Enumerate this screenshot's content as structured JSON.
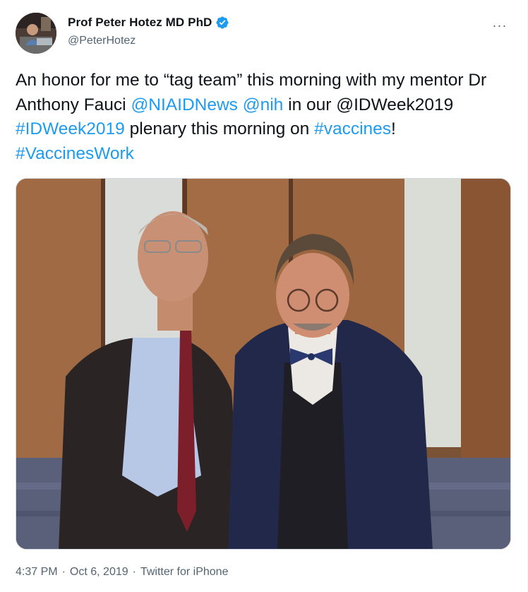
{
  "author": {
    "name": "Prof Peter Hotez MD PhD",
    "handle": "@PeterHotez",
    "verified": true,
    "avatar_icon": "profile-avatar"
  },
  "more_icon": "ellipsis-icon",
  "more_label": "···",
  "tweet": {
    "segments": [
      {
        "text": "An honor for me to “tag team” this morning with my mentor Dr Anthony Fauci ",
        "link": false
      },
      {
        "text": "@NIAIDNews",
        "link": true
      },
      {
        "text": " ",
        "link": false
      },
      {
        "text": "@nih",
        "link": true
      },
      {
        "text": " in our @IDWeek2019 ",
        "link": false
      },
      {
        "text": "#IDWeek2019",
        "link": true
      },
      {
        "text": " plenary this morning on ",
        "link": false
      },
      {
        "text": "#vaccines",
        "link": true
      },
      {
        "text": "! ",
        "link": false
      },
      {
        "text": "#VaccinesWork",
        "link": true
      }
    ]
  },
  "media": {
    "kind": "photo"
  },
  "meta": {
    "time": "4:37 PM",
    "separator": "·",
    "date": "Oct 6, 2019",
    "source": "Twitter for iPhone"
  },
  "colors": {
    "link": "#1d9bf0",
    "text": "#0f1419",
    "secondary": "#536471",
    "verified": "#1d9bf0"
  }
}
